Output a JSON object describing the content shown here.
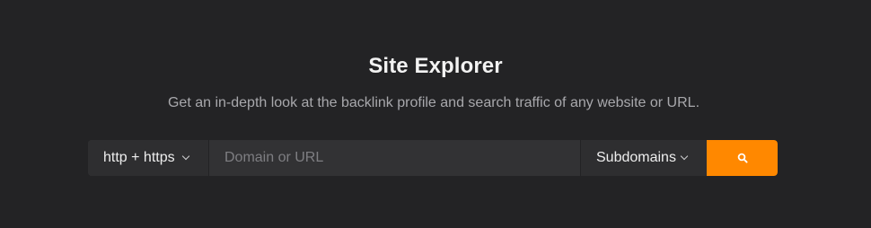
{
  "hero": {
    "title": "Site Explorer",
    "subtitle": "Get an in-depth look at the backlink profile and search traffic of any website or URL."
  },
  "search": {
    "protocol_selected": "http + https",
    "input_placeholder": "Domain or URL",
    "input_value": "",
    "mode_selected": "Subdomains",
    "button_icon": "search-icon",
    "accent_color": "#ff8800"
  }
}
